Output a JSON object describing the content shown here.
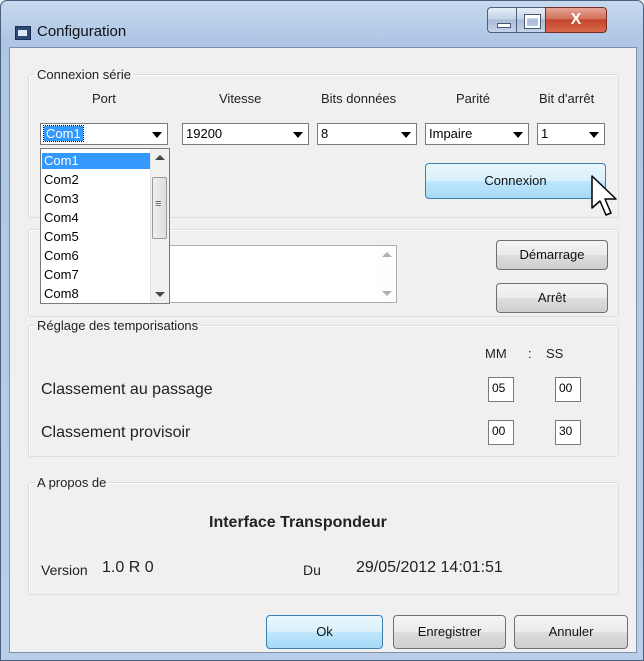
{
  "window": {
    "title": "Configuration",
    "close_symbol": "X"
  },
  "serial": {
    "legend": "Connexion série",
    "port": {
      "label": "Port",
      "value": "Com1"
    },
    "vitesse": {
      "label": "Vitesse",
      "value": "19200"
    },
    "bits": {
      "label": "Bits données",
      "value": "8"
    },
    "parite": {
      "label": "Parité",
      "value": "Impaire"
    },
    "arret": {
      "label": "Bit d'arrêt",
      "value": "1"
    },
    "port_options": [
      "Com1",
      "Com2",
      "Com3",
      "Com4",
      "Com5",
      "Com6",
      "Com7",
      "Com8"
    ],
    "connect_button": "Connexion"
  },
  "control": {
    "start_button": "Démarrage",
    "stop_button": "Arrêt"
  },
  "timing": {
    "legend": "Réglage des temporisations",
    "mm_label": "MM",
    "sep": ":",
    "ss_label": "SS",
    "rows": [
      {
        "label": "Classement au passage",
        "mm": "05",
        "ss": "00"
      },
      {
        "label": "Classement provisoir",
        "mm": "00",
        "ss": "30"
      }
    ]
  },
  "about": {
    "legend": "A propos de",
    "product": "Interface Transpondeur",
    "version_label": "Version",
    "version_value": "1.0 R 0",
    "date_label": "Du",
    "date_value": "29/05/2012 14:01:51"
  },
  "buttons": {
    "ok": "Ok",
    "save": "Enregistrer",
    "cancel": "Annuler"
  }
}
